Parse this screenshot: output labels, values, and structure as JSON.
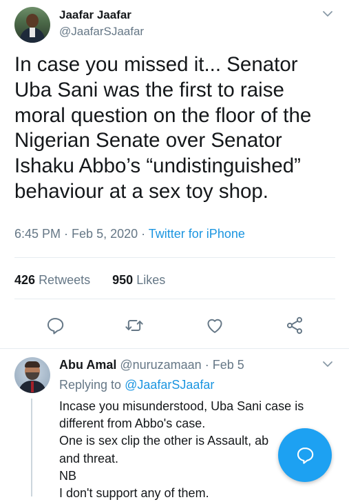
{
  "tweet": {
    "author_name": "Jaafar Jaafar",
    "author_handle": "@JaafarSJaafar",
    "text": "In case you missed it... Senator\nUba Sani was the first to raise\nmoral question on the floor of the\nNigerian Senate over Senator\nIshaku Abbo’s “undistinguished”\nbehaviour at a sex toy shop.",
    "time": "6:45 PM",
    "sep1": " · ",
    "date": "Feb 5, 2020",
    "sep2": " · ",
    "source": "Twitter for iPhone",
    "retweets_count": "426",
    "retweets_label": "Retweets",
    "likes_count": "950",
    "likes_label": "Likes"
  },
  "icons": {
    "reply": "reply-icon",
    "retweet": "retweet-icon",
    "like": "heart-icon",
    "share": "share-icon",
    "more": "chevron-down-icon",
    "compose": "compose-reply-icon"
  },
  "reply": {
    "author_name": "Abu Amal",
    "author_handle": "@nuruzamaan",
    "sep": " · ",
    "date": "Feb 5",
    "replying_prefix": "Replying to ",
    "replying_to": "@JaafarSJaafar",
    "lines": [
      "Incase you misunderstood, Uba Sani case is",
      "different from Abbo's case.",
      "One is sex clip the other is Assault, ab",
      "and threat.",
      "NB",
      "I don't support any of them."
    ]
  },
  "colors": {
    "accent": "#1da1f2",
    "link": "#1b95e0",
    "secondary_text": "#657786",
    "divider": "#e6ecf0"
  }
}
